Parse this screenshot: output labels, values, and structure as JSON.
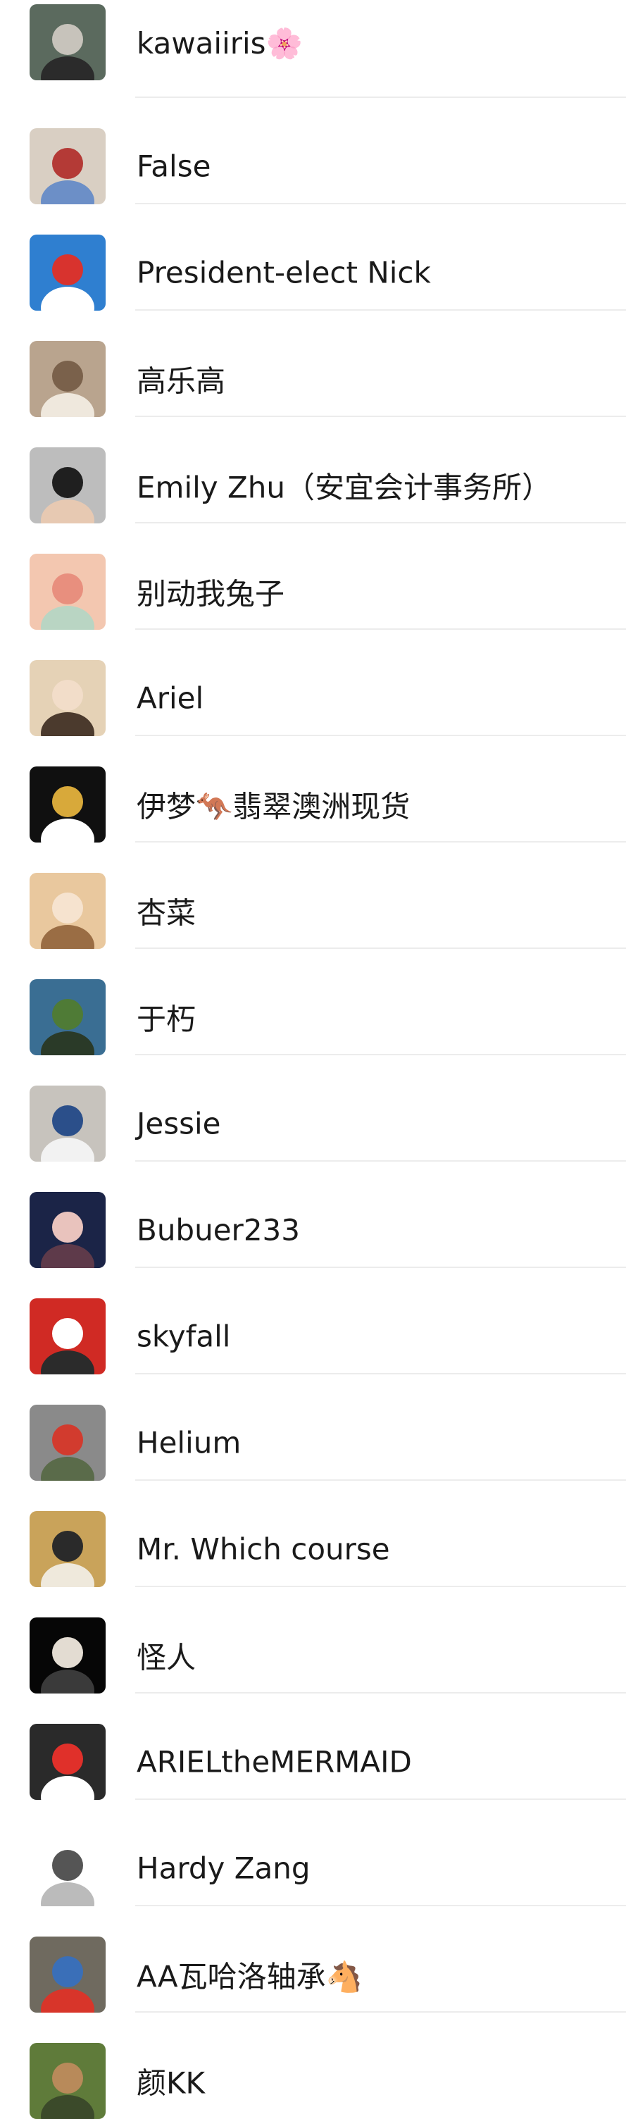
{
  "contacts": [
    {
      "name": "kawaiiris🌸",
      "avatar": "woman-photo-avatar",
      "colors": [
        "#5b6a5e",
        "#c7c3bb",
        "#2b2b2b"
      ]
    },
    {
      "name": "False",
      "avatar": "couple-photo-avatar",
      "colors": [
        "#d9cfc3",
        "#b43a36",
        "#6c8fc7"
      ]
    },
    {
      "name": "President-elect Nick",
      "avatar": "airplane-cartoon-avatar",
      "colors": [
        "#2f7fd0",
        "#d8332e",
        "#ffffff"
      ]
    },
    {
      "name": "高乐高",
      "avatar": "dogs-photo-avatar",
      "colors": [
        "#b9a48e",
        "#7a614b",
        "#efe8dd"
      ]
    },
    {
      "name": "Emily Zhu（安宜会计事务所）",
      "avatar": "woman-portrait-avatar",
      "colors": [
        "#bdbdbd",
        "#1f1f1f",
        "#e7c9b2"
      ]
    },
    {
      "name": "别动我兔子",
      "avatar": "girl-selfie-avatar",
      "colors": [
        "#f3c7b0",
        "#e88f7e",
        "#b9d5c3"
      ]
    },
    {
      "name": "Ariel",
      "avatar": "blonde-portrait-avatar",
      "colors": [
        "#e5d2b6",
        "#f2ddc9",
        "#4b3a2d"
      ]
    },
    {
      "name": "伊梦🦘翡翠澳洲现货",
      "avatar": "panda-gold-avatar",
      "colors": [
        "#101010",
        "#d8a93a",
        "#ffffff"
      ]
    },
    {
      "name": "杏菜",
      "avatar": "blonde-doll-avatar",
      "colors": [
        "#e9c89e",
        "#f6e3cf",
        "#9a6d44"
      ]
    },
    {
      "name": "于朽",
      "avatar": "park-photo-avatar",
      "colors": [
        "#3a6e93",
        "#4f7b36",
        "#2a3a28"
      ]
    },
    {
      "name": "Jessie",
      "avatar": "child-panda-avatar",
      "colors": [
        "#c7c3bd",
        "#2b4f8a",
        "#f2f2f2"
      ]
    },
    {
      "name": "Bubuer233",
      "avatar": "dark-portrait-avatar",
      "colors": [
        "#1b2447",
        "#e9c3bd",
        "#5e3a4a"
      ]
    },
    {
      "name": "skyfall",
      "avatar": "red-fox-toy-avatar",
      "colors": [
        "#d02a24",
        "#ffffff",
        "#2b2b2b"
      ]
    },
    {
      "name": "Helium",
      "avatar": "mermaid-cartoon-avatar",
      "colors": [
        "#8a8a8a",
        "#d23b2e",
        "#5a6b4a"
      ]
    },
    {
      "name": "Mr. Which course",
      "avatar": "warrior-drawing-avatar",
      "colors": [
        "#c9a35a",
        "#2a2a2a",
        "#efe9dc"
      ]
    },
    {
      "name": "怪人",
      "avatar": "skull-mask-avatar",
      "colors": [
        "#060606",
        "#e3dcd2",
        "#3a3a3a"
      ]
    },
    {
      "name": "ARIELtheMERMAID",
      "avatar": "red-hair-figure-avatar",
      "colors": [
        "#2a2a2a",
        "#e0302a",
        "#ffffff"
      ]
    },
    {
      "name": "Hardy Zang",
      "avatar": "sketch-figure-avatar",
      "colors": [
        "#ffffff",
        "#555555",
        "#bbbbbb"
      ]
    },
    {
      "name": "AA瓦哈洛轴承🐴",
      "avatar": "outdoor-child-avatar",
      "colors": [
        "#6f6a5f",
        "#3a6fb8",
        "#d8352a"
      ]
    },
    {
      "name": "颜KK",
      "avatar": "cat-garden-avatar",
      "colors": [
        "#5f7b3a",
        "#b88a5a",
        "#3b4a2a"
      ]
    }
  ]
}
